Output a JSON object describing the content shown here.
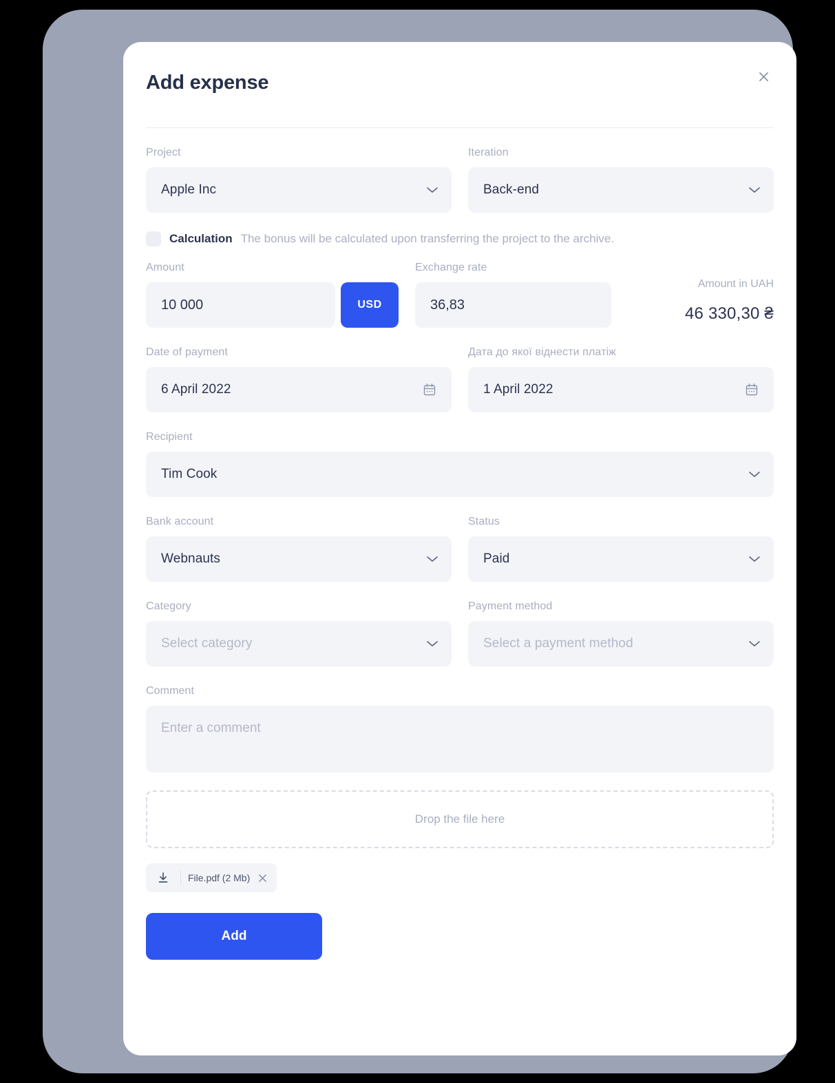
{
  "modal": {
    "title": "Add expense",
    "close_icon": "close-icon"
  },
  "fields": {
    "project": {
      "label": "Project",
      "value": "Apple Inc"
    },
    "iteration": {
      "label": "Iteration",
      "value": "Back-end"
    },
    "calculation": {
      "label": "Calculation",
      "hint": "The bonus will be calculated upon transferring the project to the archive.",
      "checked": false
    },
    "amount": {
      "label": "Amount",
      "value": "10 000",
      "currency": "USD"
    },
    "exchange_rate": {
      "label": "Exchange rate",
      "value": "36,83"
    },
    "amount_uah": {
      "label": "Amount in UAH",
      "value": "46 330,30 ₴"
    },
    "date_of_payment": {
      "label": "Date of payment",
      "value": "6 April 2022",
      "icon": "calendar-icon"
    },
    "date_attribution": {
      "label": "Дата до якої віднести платіж",
      "value": "1 April 2022",
      "icon": "calendar-icon"
    },
    "recipient": {
      "label": "Recipient",
      "value": "Tim Cook"
    },
    "bank_account": {
      "label": "Bank account",
      "value": "Webnauts"
    },
    "status": {
      "label": "Status",
      "value": "Paid"
    },
    "category": {
      "label": "Category",
      "placeholder": "Select category"
    },
    "payment_method": {
      "label": "Payment method",
      "placeholder": "Select a payment method"
    },
    "comment": {
      "label": "Comment",
      "placeholder": "Enter a comment"
    }
  },
  "dropzone": {
    "text": "Drop the file here"
  },
  "attachment": {
    "name": "File.pdf  (2 Mb)",
    "download_icon": "download-icon",
    "remove_icon": "close-icon"
  },
  "actions": {
    "submit_label": "Add"
  },
  "colors": {
    "accent": "#2f55f0",
    "frame": "#9ba3b5",
    "field_bg": "#f3f4f8",
    "text_dark": "#2b3350",
    "text_muted": "#a8aec0"
  }
}
